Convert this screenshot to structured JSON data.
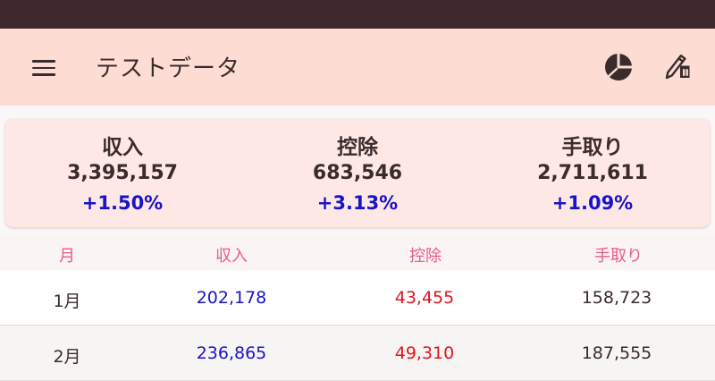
{
  "app_bar": {
    "title": "テストデータ",
    "icons": [
      "menu-icon",
      "pie-chart-icon",
      "edit-icon"
    ]
  },
  "summary": [
    {
      "label": "収入",
      "value": "3,395,157",
      "change": "+1.50%"
    },
    {
      "label": "控除",
      "value": "683,546",
      "change": "+3.13%"
    },
    {
      "label": "手取り",
      "value": "2,711,611",
      "change": "+1.09%"
    }
  ],
  "table": {
    "headers": [
      "月",
      "収入",
      "控除",
      "手取り"
    ],
    "rows": [
      {
        "month": "1月",
        "income": "202,178",
        "deduction": "43,455",
        "net": "158,723"
      },
      {
        "month": "2月",
        "income": "236,865",
        "deduction": "49,310",
        "net": "187,555"
      }
    ]
  },
  "colors": {
    "status_bar": "#3e2a2e",
    "app_bar": "#fddcd3",
    "card": "#fde8e6",
    "header_text": "#e95b88",
    "income": "#1a14c8",
    "deduction": "#e0141e",
    "text": "#3a2b2c"
  }
}
